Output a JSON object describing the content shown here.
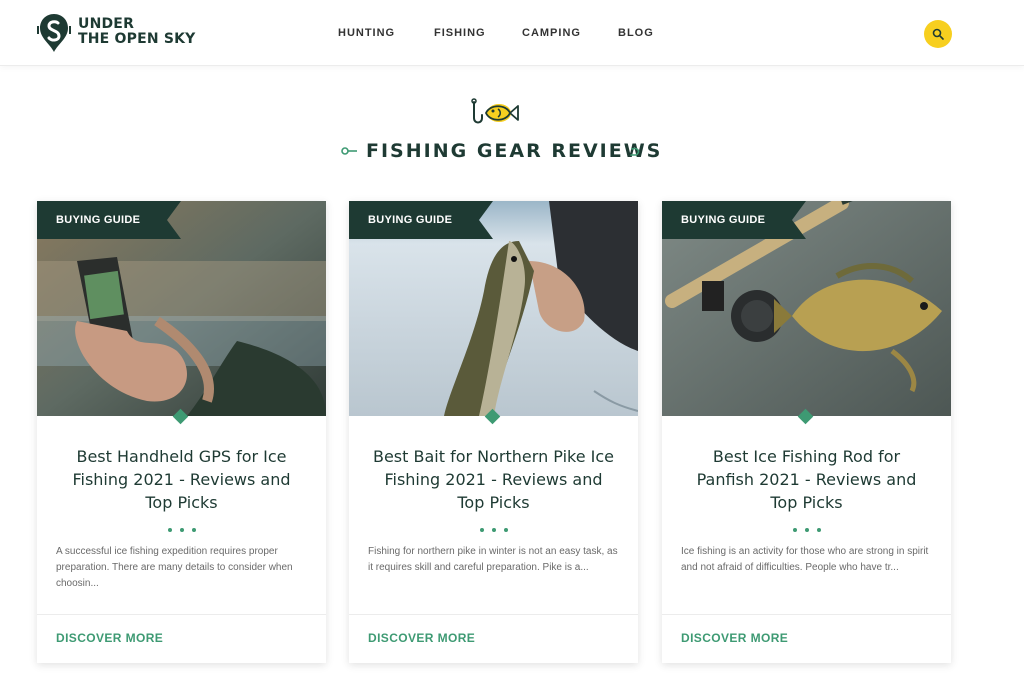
{
  "site": {
    "brand_line1": "UNDER",
    "brand_line2": "THE OPEN SKY"
  },
  "nav": {
    "items": [
      {
        "label": "HUNTING"
      },
      {
        "label": "FISHING",
        "active": true
      },
      {
        "label": "CAMPING"
      },
      {
        "label": "BLOG"
      }
    ]
  },
  "section": {
    "title": "FISHING GEAR REVIEWS",
    "icon": "fish-hook-icon"
  },
  "cards": [
    {
      "badge": "BUYING GUIDE",
      "image": "handheld-gps-photo",
      "title": "Best Handheld GPS for Ice Fishing 2021 - Reviews and Top Picks",
      "excerpt": "A successful ice fishing expedition requires proper preparation. There are many details to consider when choosin...",
      "cta": "DISCOVER MORE"
    },
    {
      "badge": "BUYING GUIDE",
      "image": "northern-pike-photo",
      "title": "Best Bait for Northern Pike Ice Fishing 2021 - Reviews and Top Picks",
      "excerpt": "Fishing for northern pike in winter is not an easy task, as it requires skill and careful preparation. Pike is a...",
      "cta": "DISCOVER MORE"
    },
    {
      "badge": "BUYING GUIDE",
      "image": "panfish-rod-photo",
      "title": "Best Ice Fishing Rod for Panfish 2021 - Reviews and Top Picks",
      "excerpt": "Ice fishing is an activity for those who are strong in spirit and not afraid of difficulties. People who have tr...",
      "cta": "DISCOVER MORE"
    }
  ],
  "colors": {
    "brand_dark": "#1e3a33",
    "accent_green": "#3e9a73",
    "accent_yellow": "#f7cf1f"
  }
}
